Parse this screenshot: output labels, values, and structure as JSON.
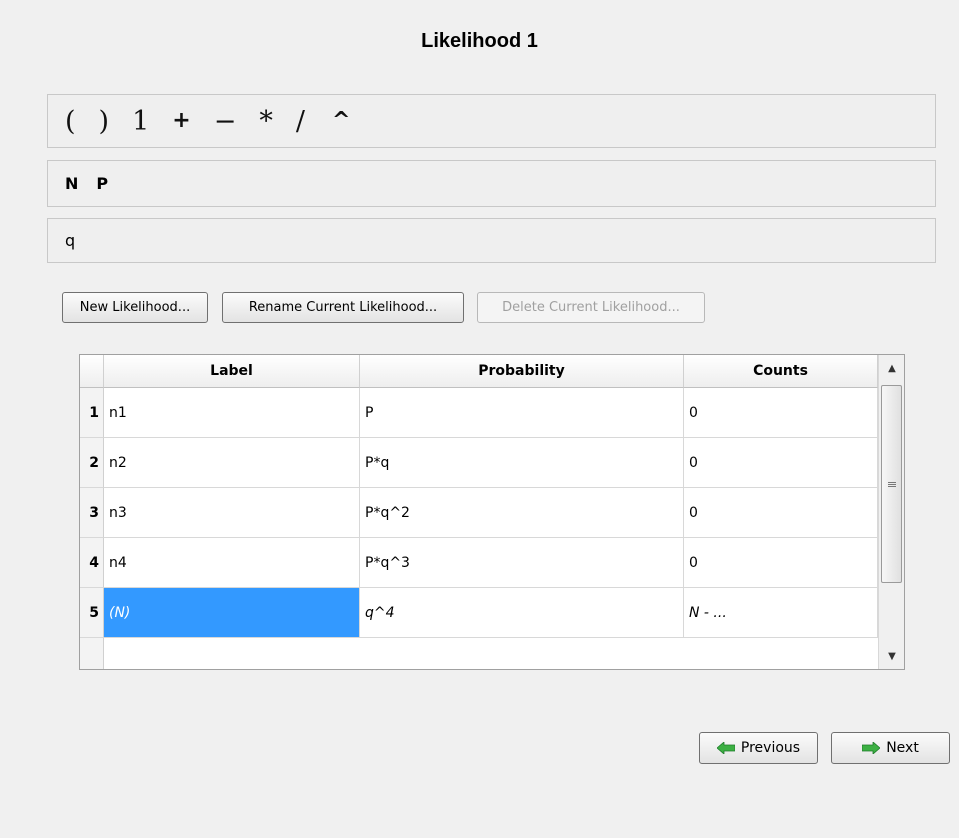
{
  "title": "Likelihood 1",
  "operators": [
    "(",
    ")",
    "1",
    "+",
    "−",
    "*",
    "/",
    "^"
  ],
  "parameters": [
    "N",
    "P"
  ],
  "variables": [
    "q"
  ],
  "buttons": {
    "new": "New Likelihood...",
    "rename": "Rename Current Likelihood...",
    "delete": "Delete Current Likelihood..."
  },
  "table": {
    "columns": [
      "Label",
      "Probability",
      "Counts"
    ],
    "rows": [
      {
        "num": "1",
        "label": "n1",
        "probability": "P",
        "counts": "0"
      },
      {
        "num": "2",
        "label": "n2",
        "probability": "P*q",
        "counts": "0"
      },
      {
        "num": "3",
        "label": "n3",
        "probability": "P*q^2",
        "counts": "0"
      },
      {
        "num": "4",
        "label": "n4",
        "probability": "P*q^3",
        "counts": "0"
      },
      {
        "num": "5",
        "label": "(N)",
        "probability": "q^4",
        "counts": "N - ..."
      }
    ]
  },
  "nav": {
    "previous": "Previous",
    "next": "Next"
  },
  "colors": {
    "selection": "#3399ff",
    "arrow_green": "#3cb043"
  },
  "icons": {
    "previous": "arrow-left-icon",
    "next": "arrow-right-icon"
  }
}
